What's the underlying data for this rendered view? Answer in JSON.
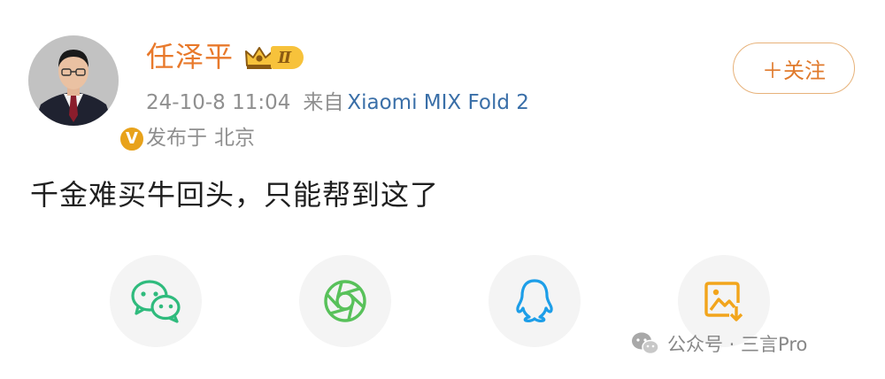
{
  "post": {
    "author": {
      "name": "任泽平",
      "vip_level": "Ⅱ",
      "verified_mark": "V"
    },
    "follow_label": "＋关注",
    "timestamp": "24-10-8 11:04",
    "source_prefix": "来自",
    "device": "Xiaomi MIX Fold 2",
    "location_prefix": "发布于",
    "location": "北京",
    "text": "千金难买牛回头，只能帮到这了"
  },
  "share_bar": [
    {
      "icon": "wechat-icon",
      "color": "#2fbb7d"
    },
    {
      "icon": "moments-icon",
      "color": "#58c15a"
    },
    {
      "icon": "qq-icon",
      "color": "#1d9ee8"
    },
    {
      "icon": "save-image-icon",
      "color": "#f2a51c"
    }
  ],
  "watermark": {
    "text": "公众号 · 三言Pro"
  },
  "colors": {
    "name": "#e8792b",
    "device_link": "#3a6fa8",
    "meta_text": "#8f8f8f",
    "vip_gold": "#f7c23b",
    "follow_border": "#e7b27a"
  }
}
